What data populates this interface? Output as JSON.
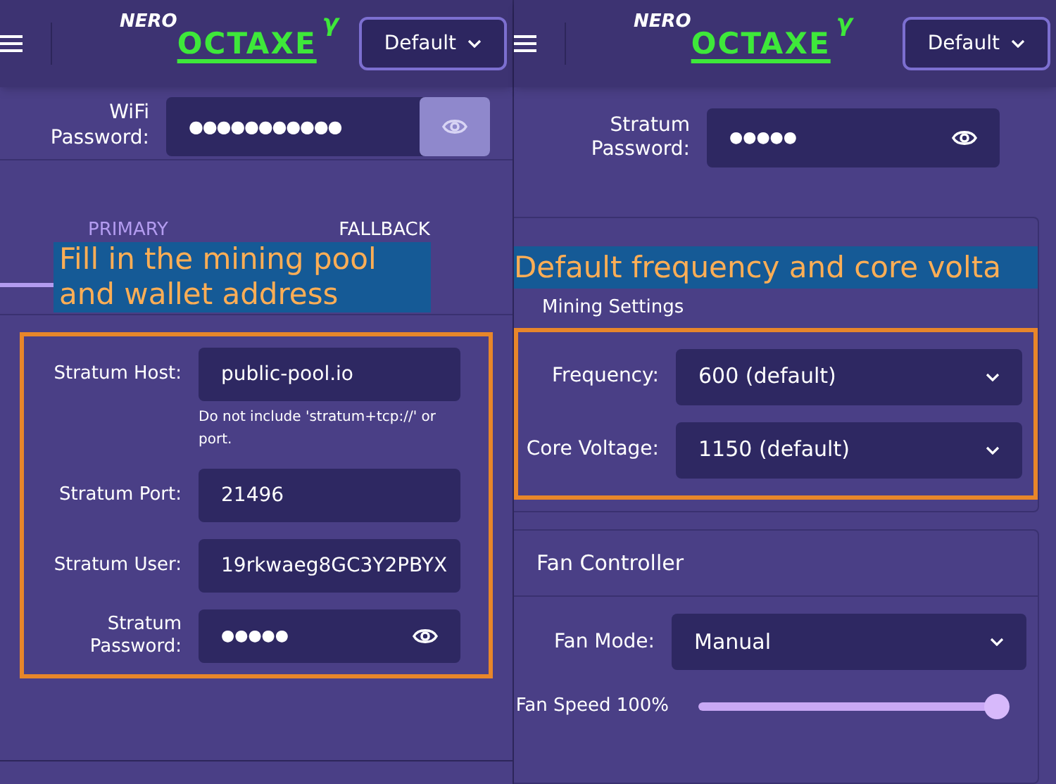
{
  "left": {
    "header": {
      "logo_small": "NERO",
      "logo": "OCTAXE",
      "logo_sup": "γ",
      "profile": "Default"
    },
    "wifi_password": {
      "label": "WiFi Password:",
      "value": "●●●●●●●●●●●",
      "eye_highlighted": true
    },
    "tabs": [
      {
        "label": "PRIMARY",
        "selected": true
      },
      {
        "label": "FALLBACK",
        "selected": false
      }
    ],
    "caption": "Fill in the mining pool and wallet address",
    "fields": [
      {
        "kind": "text",
        "label": "Stratum Host:",
        "value": "public-pool.io",
        "hint": "Do not include 'stratum+tcp://' or port."
      },
      {
        "kind": "text",
        "label": "Stratum Port:",
        "value": "21496"
      },
      {
        "kind": "text",
        "label": "Stratum User:",
        "value": "19rkwaeg8GC3Y2PBYX"
      },
      {
        "kind": "password",
        "label": "Stratum Password:",
        "value": "●●●●●"
      }
    ]
  },
  "right": {
    "header": {
      "logo_small": "NERO",
      "logo": "OCTAXE",
      "logo_sup": "γ",
      "profile": "Default"
    },
    "stratum_password": {
      "label": "Stratum Password:",
      "value": "●●●●●",
      "eye_highlighted": false
    },
    "mining_settings": {
      "title": "Mining Settings",
      "caption": "Default frequency and core volta",
      "selects": [
        {
          "label": "Frequency:",
          "value": "600 (default)"
        },
        {
          "label": "Core Voltage:",
          "value": "1150 (default)"
        }
      ]
    },
    "fan_controller": {
      "title": "Fan Controller",
      "fan_mode": {
        "label": "Fan Mode:",
        "value": "Manual"
      },
      "fan_speed": {
        "label": "Fan Speed 100%",
        "level": 1
      }
    }
  }
}
